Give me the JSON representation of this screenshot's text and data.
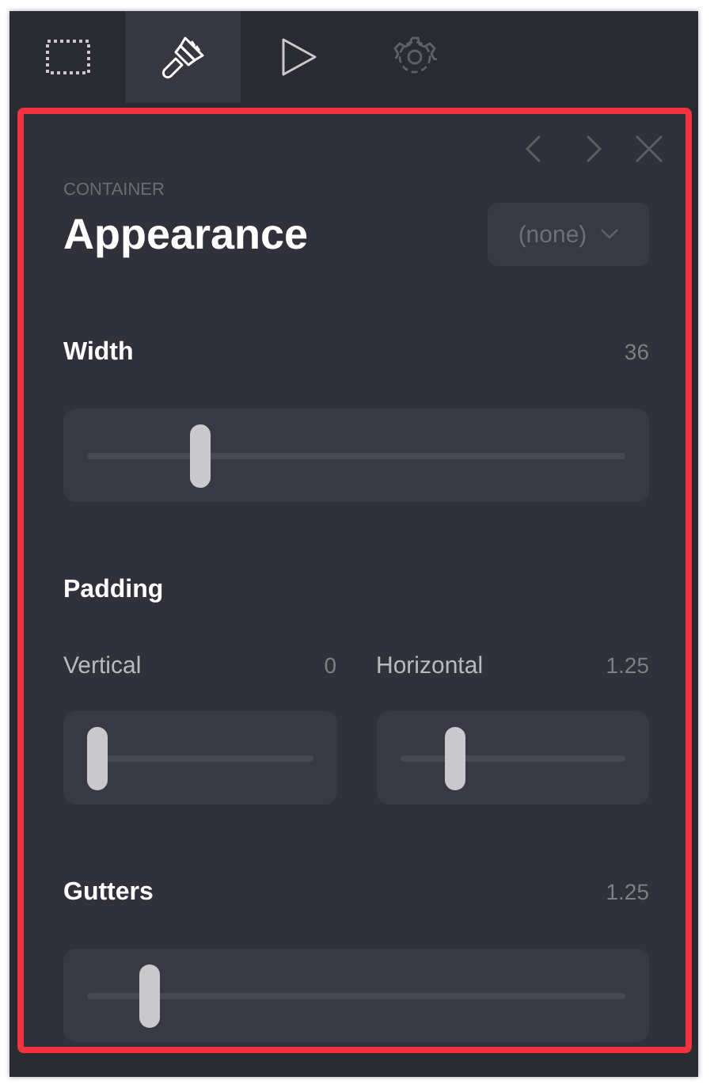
{
  "toolbar": {
    "tabs": [
      {
        "kind": "selection",
        "selected": false
      },
      {
        "kind": "brush",
        "selected": true
      },
      {
        "kind": "play",
        "selected": false
      },
      {
        "kind": "settings",
        "selected": false
      }
    ]
  },
  "panel": {
    "highlighted": true,
    "eyebrow": "CONTAINER",
    "title": "Appearance",
    "dropdown": {
      "value": "(none)"
    },
    "sections": [
      {
        "kind": "single",
        "label": "Width",
        "value": "36",
        "level": 0.2
      },
      {
        "kind": "pair",
        "label": "Padding",
        "controls": [
          {
            "label": "Vertical",
            "value": "0",
            "level": 0
          },
          {
            "label": "Horizontal",
            "value": "1.25",
            "level": 0.22
          }
        ]
      },
      {
        "kind": "single",
        "label": "Gutters",
        "value": "1.25",
        "level": 0.1
      }
    ]
  }
}
